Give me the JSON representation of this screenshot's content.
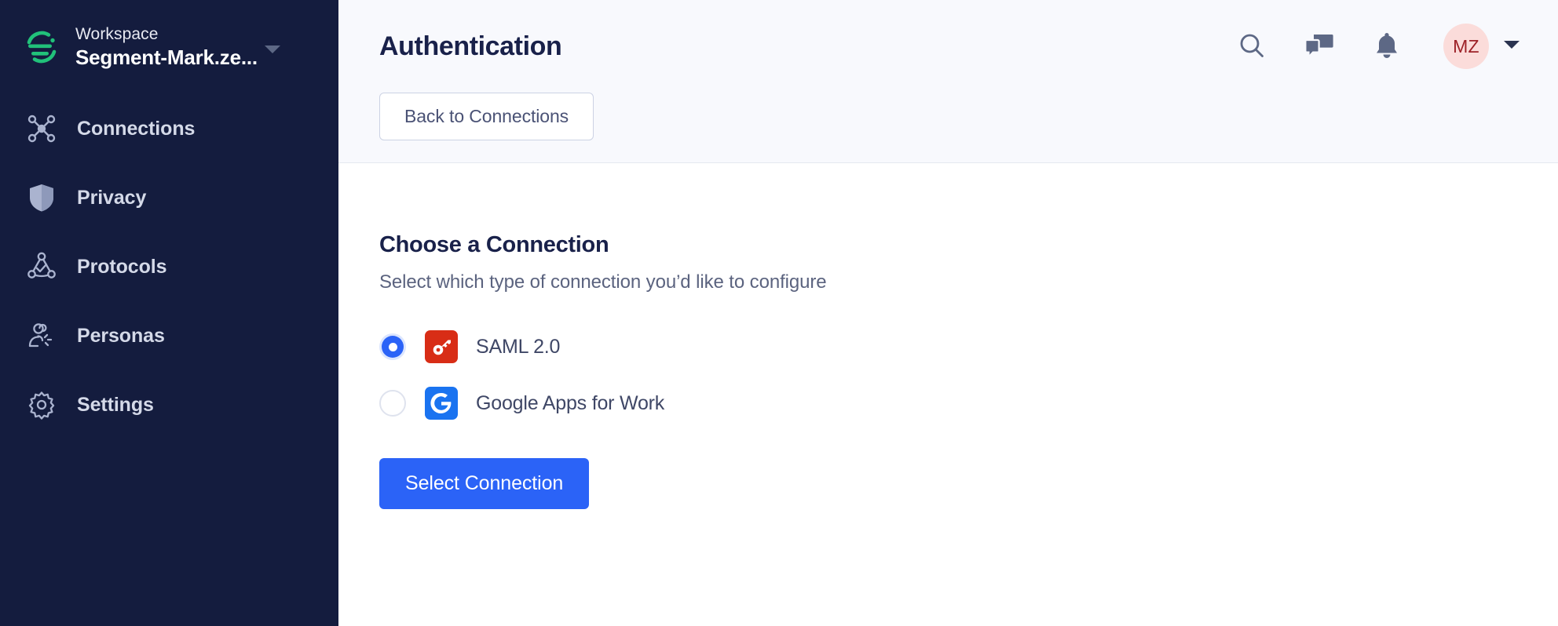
{
  "sidebar": {
    "logo_icon": "segment-logo-icon",
    "workspace_label": "Workspace",
    "workspace_name": "Segment-Mark.ze...",
    "workspace_caret_icon": "caret-down-icon",
    "items": [
      {
        "label": "Connections",
        "icon": "connections-icon"
      },
      {
        "label": "Privacy",
        "icon": "shield-icon"
      },
      {
        "label": "Protocols",
        "icon": "protocols-icon"
      },
      {
        "label": "Personas",
        "icon": "personas-icon"
      },
      {
        "label": "Settings",
        "icon": "gear-icon"
      }
    ]
  },
  "topbar": {
    "title": "Authentication",
    "search_icon": "search-icon",
    "chat_icon": "chat-bubbles-icon",
    "bell_icon": "bell-icon",
    "avatar_initials": "MZ",
    "avatar_caret_icon": "caret-down-icon"
  },
  "subbar": {
    "back_label": "Back to Connections"
  },
  "main": {
    "heading": "Choose a Connection",
    "subheading": "Select which type of connection you’d like to configure",
    "options": [
      {
        "label": "SAML 2.0",
        "icon": "key-icon",
        "selected": true
      },
      {
        "label": "Google Apps for Work",
        "icon": "google-g-icon",
        "selected": false
      }
    ],
    "submit_label": "Select Connection"
  },
  "colors": {
    "sidebar_bg": "#141c3e",
    "header_bg": "#f8f9fd",
    "primary_blue": "#2b63f7",
    "saml_red": "#d82d16",
    "google_blue": "#1a73f0",
    "avatar_bg": "#fbdcda",
    "avatar_text": "#9d2228",
    "logo_green": "#21c17a"
  }
}
